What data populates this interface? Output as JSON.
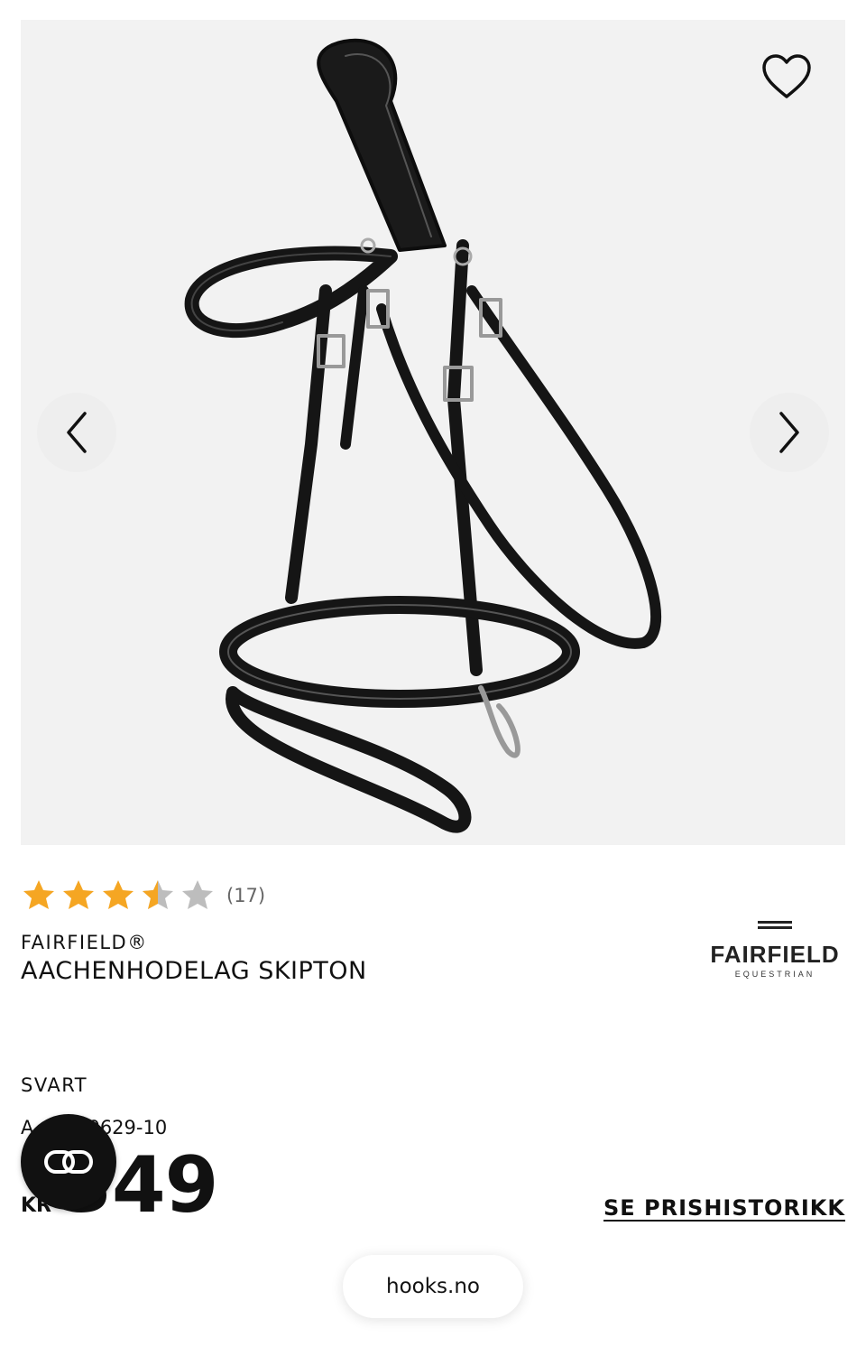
{
  "gallery": {
    "image_alt": "Aachenhodelag Skipton",
    "favorite_icon": "heart-outline-icon",
    "prev_icon": "chevron-left-icon",
    "next_icon": "chevron-right-icon"
  },
  "rating": {
    "value": 3.5,
    "max": 5,
    "count_label": "(17)",
    "filled_color": "#f5a623",
    "empty_color": "#bdbdbd"
  },
  "product": {
    "brand": "FAIRFIELD®",
    "title": "AACHENHODELAG SKIPTON",
    "variant": "SVART",
    "sku": "A     200629-10",
    "currency": "KR",
    "price": "349"
  },
  "brand_logo": {
    "name": "FAIRFIELD",
    "subtitle": "EQUESTRIAN"
  },
  "links": {
    "price_history": "SE PRISHISTORIKK"
  },
  "widget": {
    "icon": "link-icon"
  },
  "browser": {
    "url": "hooks.no"
  }
}
